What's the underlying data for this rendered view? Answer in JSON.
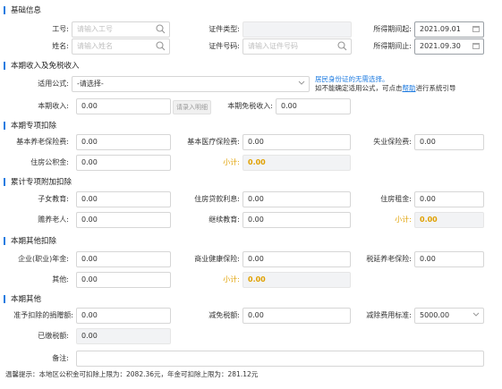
{
  "basic": {
    "title": "基础信息",
    "job_no_label": "工号:",
    "job_no_ph": "请输入工号",
    "name_label": "姓名:",
    "name_ph": "请输入姓名",
    "cert_type_label": "证件类型:",
    "cert_no_label": "证件号码:",
    "cert_no_ph": "请输入证件号码",
    "period_start_label": "所得期间起:",
    "period_start": "2021.09.01",
    "period_end_label": "所得期间止:",
    "period_end": "2021.09.30"
  },
  "income": {
    "title": "本期收入及免税收入",
    "formula_label": "适用公式:",
    "formula_value": "-请选择-",
    "note_line1": "居民身份证的无需选择。",
    "note_line2_pre": "如不能确定适用公式，可点击",
    "note_link": "帮助",
    "note_line2_post": "进行系统引导",
    "income_label": "本期收入:",
    "income_value": "0.00",
    "detail_btn": "请录入明细",
    "taxfree_label": "本期免税收入:",
    "taxfree_value": "0.00"
  },
  "special": {
    "title": "本期专项扣除",
    "pension_label": "基本养老保险费:",
    "pension_value": "0.00",
    "medical_label": "基本医疗保险费:",
    "medical_value": "0.00",
    "unemploy_label": "失业保险费:",
    "unemploy_value": "0.00",
    "housing_label": "住房公积金:",
    "housing_value": "0.00",
    "subtotal_label": "小计:",
    "subtotal_value": "0.00"
  },
  "additional": {
    "title": "累计专项附加扣除",
    "child_label": "子女教育:",
    "child_value": "0.00",
    "loan_label": "住房贷款利息:",
    "loan_value": "0.00",
    "rent_label": "住房租金:",
    "rent_value": "0.00",
    "elder_label": "赡养老人:",
    "elder_value": "0.00",
    "cont_edu_label": "继续教育:",
    "cont_edu_value": "0.00",
    "subtotal_label": "小计:",
    "subtotal_value": "0.00"
  },
  "other_ded": {
    "title": "本期其他扣除",
    "annuity_label": "企业(职业)年金:",
    "annuity_value": "0.00",
    "health_label": "商业健康保险:",
    "health_value": "0.00",
    "deferred_label": "税延养老保险:",
    "deferred_value": "0.00",
    "other_label": "其他:",
    "other_value": "0.00",
    "subtotal_label": "小计:",
    "subtotal_value": "0.00"
  },
  "other": {
    "title": "本期其他",
    "donation_label": "准予扣除的捐赠额:",
    "donation_value": "0.00",
    "relief_label": "减免税额:",
    "relief_value": "0.00",
    "deduction_label": "减除费用标准:",
    "deduction_value": "5000.00",
    "paid_label": "已缴税额:",
    "paid_value": "0.00",
    "remark_label": "备注:",
    "remark_value": ""
  },
  "footer": {
    "tip": "温馨提示：本地区公积金可扣除上限为：2082.36元，年金可扣除上限为：281.12元"
  },
  "colors": {
    "accent": "#1e7be0",
    "subtotal": "#e0a000"
  },
  "icons": [
    "search-icon",
    "calendar-icon",
    "chevron-down-icon"
  ]
}
